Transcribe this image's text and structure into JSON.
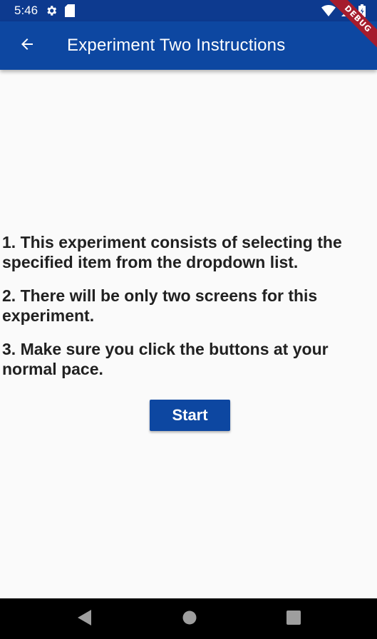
{
  "status_bar": {
    "time": "5:46",
    "left_icons": [
      "gear-icon",
      "sd-card-icon"
    ],
    "right_icons": [
      "wifi-icon",
      "signal-icon",
      "battery-icon"
    ]
  },
  "debug_banner": {
    "label": "DEBUG",
    "color": "#a51c2d"
  },
  "app_bar": {
    "title": "Experiment Two Instructions",
    "back_icon": "arrow-back-icon",
    "color": "#0d47a1"
  },
  "instructions": [
    "1. This experiment consists of selecting the specified item from the dropdown list.",
    "2. There will be only two screens for this experiment.",
    "3. Make sure you click the buttons at your normal pace."
  ],
  "start_button": {
    "label": "Start",
    "color": "#0d47a1"
  },
  "nav_bar": {
    "items": [
      "back-triangle-icon",
      "home-circle-icon",
      "recents-square-icon"
    ]
  }
}
